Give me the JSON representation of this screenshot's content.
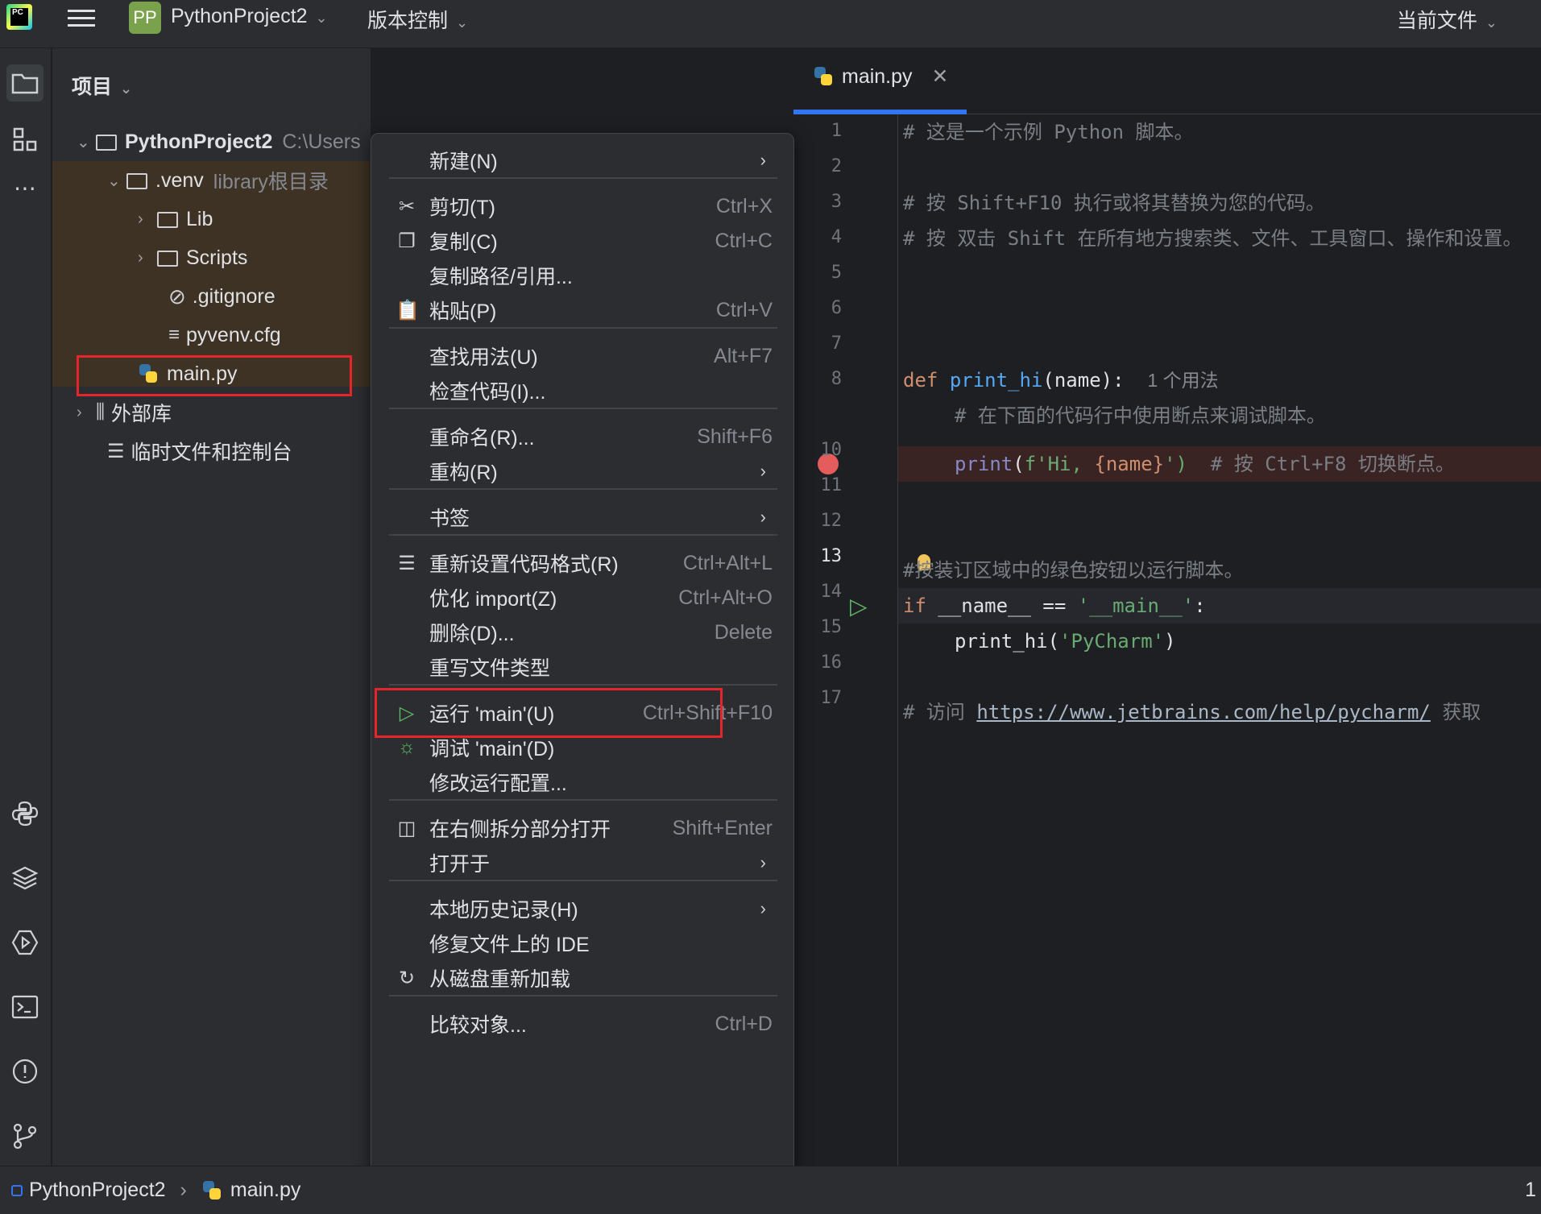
{
  "titlebar": {
    "project_badge": "PP",
    "project_name": "PythonProject2",
    "vcs": "版本控制",
    "current_file": "当前文件"
  },
  "project_panel": {
    "title": "项目",
    "tree": [
      {
        "label": "PythonProject2",
        "hint": "C:\\Users",
        "icon": "folder-icon"
      },
      {
        "label": ".venv",
        "hint": "library根目录",
        "icon": "folder-icon"
      },
      {
        "label": "Lib",
        "icon": "folder-icon"
      },
      {
        "label": "Scripts",
        "icon": "folder-icon"
      },
      {
        "label": ".gitignore",
        "icon": "ignore-file-icon"
      },
      {
        "label": "pyvenv.cfg",
        "icon": "text-file-icon"
      },
      {
        "label": "main.py",
        "icon": "python-file-icon"
      },
      {
        "label": "外部库",
        "icon": "library-icon"
      },
      {
        "label": "临时文件和控制台",
        "icon": "scratches-icon"
      }
    ]
  },
  "editor": {
    "tab": "main.py",
    "line_numbers": [
      "1",
      "2",
      "3",
      "4",
      "5",
      "6",
      "7",
      "8",
      "",
      "10",
      "11",
      "12",
      "13",
      "14",
      "15",
      "16",
      "17"
    ],
    "lines": {
      "l1": "# 这是一个示例 Python 脚本。",
      "l3": "# 按 Shift+F10 执行或将其替换为您的代码。",
      "l4": "# 按 双击 Shift 在所有地方搜索类、文件、工具窗口、操作和设置。",
      "l7_kw": "def",
      "l7_fn": "print_hi",
      "l7_rest": "(name):",
      "l7_hint": "1 个用法",
      "l8": "# 在下面的代码行中使用断点来调试脚本。",
      "l9_bi": "print",
      "l9_str": "f'Hi, ",
      "l9_var": "{name}",
      "l9_str2": "')",
      "l9_cm": "# 按 Ctrl+F8 切换断点。",
      "l12": "#按装订区域中的绿色按钮以运行脚本。",
      "l13_kw": "if",
      "l13_rest": " __name__ == ",
      "l13_str": "'__main__'",
      "l13_end": ":",
      "l14_a": "print_hi(",
      "l14_str": "'PyCharm'",
      "l14_b": ")",
      "l16_a": "# 访问 ",
      "l16_link": "https://www.jetbrains.com/help/pycharm/",
      "l16_b": " 获取"
    }
  },
  "context_menu": [
    {
      "label": "新建(N)",
      "submenu": true
    },
    {
      "label": "剪切(T)",
      "shortcut": "Ctrl+X",
      "icon": "scissors-icon"
    },
    {
      "label": "复制(C)",
      "shortcut": "Ctrl+C",
      "icon": "copy-icon"
    },
    {
      "label": "复制路径/引用..."
    },
    {
      "label": "粘贴(P)",
      "shortcut": "Ctrl+V",
      "icon": "paste-icon"
    },
    {
      "label": "查找用法(U)",
      "shortcut": "Alt+F7"
    },
    {
      "label": "检查代码(I)..."
    },
    {
      "label": "重命名(R)...",
      "shortcut": "Shift+F6"
    },
    {
      "label": "重构(R)",
      "submenu": true
    },
    {
      "label": "书签",
      "submenu": true
    },
    {
      "label": "重新设置代码格式(R)",
      "shortcut": "Ctrl+Alt+L",
      "icon": "reformat-icon"
    },
    {
      "label": "优化 import(Z)",
      "shortcut": "Ctrl+Alt+O"
    },
    {
      "label": "删除(D)...",
      "shortcut": "Delete"
    },
    {
      "label": "重写文件类型"
    },
    {
      "label": "运行 'main'(U)",
      "shortcut": "Ctrl+Shift+F10",
      "icon": "run-icon"
    },
    {
      "label": "调试 'main'(D)",
      "icon": "debug-icon"
    },
    {
      "label": "修改运行配置..."
    },
    {
      "label": "在右侧拆分部分打开",
      "shortcut": "Shift+Enter",
      "icon": "split-icon"
    },
    {
      "label": "打开于",
      "submenu": true
    },
    {
      "label": "本地历史记录(H)",
      "submenu": true
    },
    {
      "label": "修复文件上的 IDE"
    },
    {
      "label": "从磁盘重新加载",
      "icon": "reload-icon"
    },
    {
      "label": "比较对象...",
      "shortcut": "Ctrl+D"
    }
  ],
  "statusbar": {
    "project": "PythonProject2",
    "file": "main.py",
    "right": "1"
  },
  "colors": {
    "accent": "#3574f0",
    "highlight_box": "#e5242b",
    "run_green": "#5fb865"
  }
}
